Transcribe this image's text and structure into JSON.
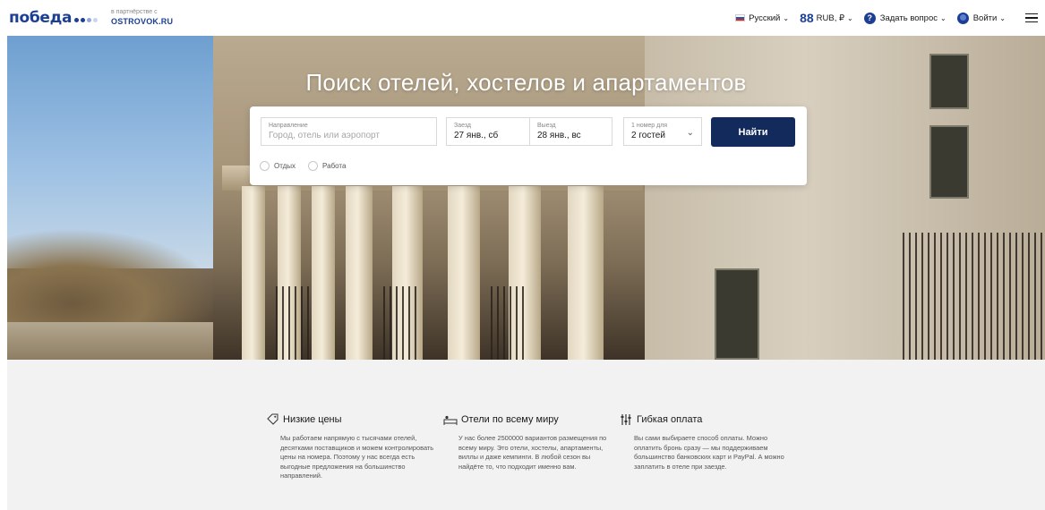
{
  "header": {
    "logo_text": "победа",
    "logo_dot_colors": [
      "#1c3f94",
      "#1c3f94",
      "#8fa7dc",
      "#c9d5ef"
    ],
    "partner_small": "в партнёрстве с",
    "partner_brand": "OSTROVOK.RU",
    "language": "Русский",
    "currency": "RUB, ₽",
    "help": "Задать вопрос",
    "login": "Войти"
  },
  "hero": {
    "title": "Поиск отелей, хостелов и апартаментов"
  },
  "search": {
    "destination_label": "Направление",
    "destination_placeholder": "Город, отель или аэропорт",
    "checkin_label": "Заезд",
    "checkin_value": "27 янв., сб",
    "checkout_label": "Выезд",
    "checkout_value": "28 янв., вс",
    "guests_label": "1 номер для",
    "guests_value": "2 гостей",
    "find_button": "Найти",
    "trip_types": [
      "Отдых",
      "Работа"
    ]
  },
  "features": [
    {
      "icon": "tag-icon",
      "title": "Низкие цены",
      "text": "Мы работаем напрямую с тысячами отелей, десятками поставщиков и можем контролировать цены на номера. Поэтому у нас всегда есть выгодные предложения на большинство направлений."
    },
    {
      "icon": "hotel-bed-icon",
      "title": "Отели по всему миру",
      "text": "У нас более 2500000 вариантов размещения по всему миру. Это отели, хостелы, апартаменты, виллы и даже кемпинги. В любой сезон вы найдёте то, что подходит именно вам."
    },
    {
      "icon": "sliders-icon",
      "title": "Гибкая оплата",
      "text": "Вы сами выбираете способ оплаты. Можно оплатить бронь сразу — мы поддерживаем большинство банковских карт и PayPal. А можно заплатить в отеле при заезде."
    }
  ],
  "colors": {
    "brand": "#1c3f94",
    "button": "#122a5c",
    "features_bg": "#f2f2f2"
  }
}
